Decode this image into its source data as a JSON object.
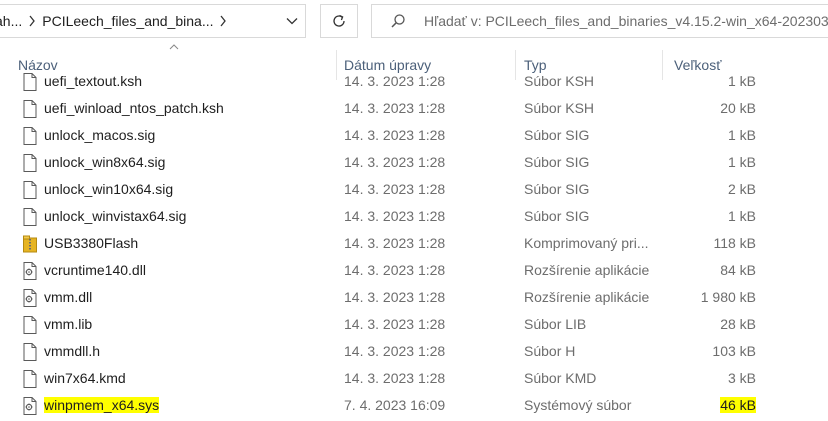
{
  "breadcrumb": {
    "segments": [
      "ah...",
      "PCILeech_files_and_bina..."
    ]
  },
  "search": {
    "placeholder": "Hľadať v: PCILeech_files_and_binaries_v4.15.2-win_x64-202303"
  },
  "columns": {
    "name": "Názov",
    "date": "Dátum úpravy",
    "type": "Typ",
    "size": "Veľkosť"
  },
  "files": [
    {
      "name": "uefi_textout.ksh",
      "date": "14. 3. 2023 1:28",
      "type": "Súbor KSH",
      "size": "1 kB",
      "icon": "blank-file-icon"
    },
    {
      "name": "uefi_winload_ntos_patch.ksh",
      "date": "14. 3. 2023 1:28",
      "type": "Súbor KSH",
      "size": "20 kB",
      "icon": "blank-file-icon"
    },
    {
      "name": "unlock_macos.sig",
      "date": "14. 3. 2023 1:28",
      "type": "Súbor SIG",
      "size": "1 kB",
      "icon": "blank-file-icon"
    },
    {
      "name": "unlock_win8x64.sig",
      "date": "14. 3. 2023 1:28",
      "type": "Súbor SIG",
      "size": "1 kB",
      "icon": "blank-file-icon"
    },
    {
      "name": "unlock_win10x64.sig",
      "date": "14. 3. 2023 1:28",
      "type": "Súbor SIG",
      "size": "2 kB",
      "icon": "blank-file-icon"
    },
    {
      "name": "unlock_winvistax64.sig",
      "date": "14. 3. 2023 1:28",
      "type": "Súbor SIG",
      "size": "1 kB",
      "icon": "blank-file-icon"
    },
    {
      "name": "USB3380Flash",
      "date": "14. 3. 2023 1:28",
      "type": "Komprimovaný pri...",
      "size": "118 kB",
      "icon": "zip-folder-icon"
    },
    {
      "name": "vcruntime140.dll",
      "date": "14. 3. 2023 1:28",
      "type": "Rozšírenie aplikácie",
      "size": "84 kB",
      "icon": "gear-file-icon"
    },
    {
      "name": "vmm.dll",
      "date": "14. 3. 2023 1:28",
      "type": "Rozšírenie aplikácie",
      "size": "1 980 kB",
      "icon": "gear-file-icon"
    },
    {
      "name": "vmm.lib",
      "date": "14. 3. 2023 1:28",
      "type": "Súbor LIB",
      "size": "28 kB",
      "icon": "blank-file-icon"
    },
    {
      "name": "vmmdll.h",
      "date": "14. 3. 2023 1:28",
      "type": "Súbor H",
      "size": "103 kB",
      "icon": "blank-file-icon"
    },
    {
      "name": "win7x64.kmd",
      "date": "14. 3. 2023 1:28",
      "type": "Súbor KMD",
      "size": "3 kB",
      "icon": "blank-file-icon"
    },
    {
      "name": "winpmem_x64.sys",
      "date": "7. 4. 2023 16:09",
      "type": "Systémový súbor",
      "size": "46 kB",
      "icon": "gear-file-icon",
      "highlighted": true
    }
  ],
  "colors": {
    "highlight": "#ffff00",
    "header_text": "#4c607a",
    "secondary_text": "#6d6d6d"
  }
}
